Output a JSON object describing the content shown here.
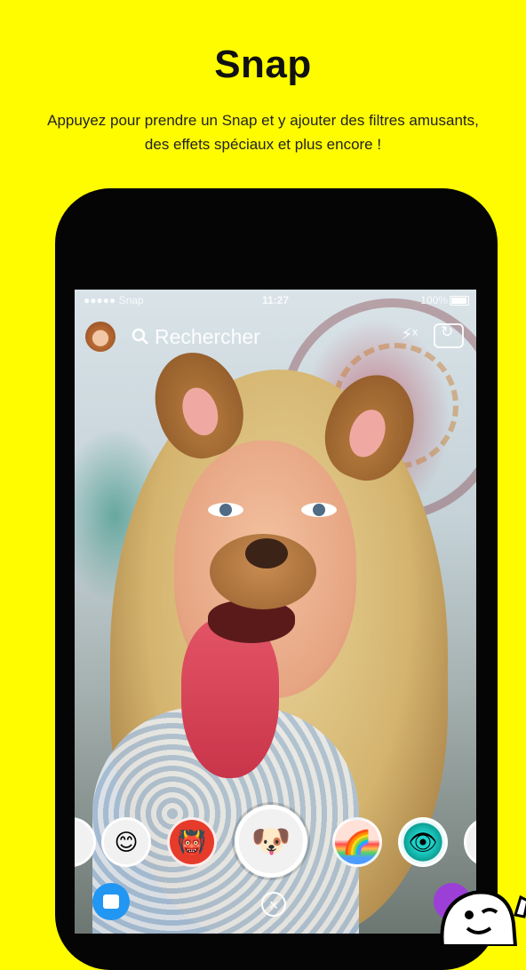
{
  "header": {
    "title": "Snap",
    "subtitle": "Appuyez pour prendre un Snap et y ajouter des filtres amusants, des effets spéciaux et plus encore !"
  },
  "status_bar": {
    "carrier": "●●●●● Snap",
    "time": "11:27",
    "battery": "100%"
  },
  "camera": {
    "search_label": "Rechercher",
    "flash_icon": "flash-off-icon",
    "flip_icon": "flip-camera-icon"
  },
  "lenses": [
    {
      "icon": "partial-lens-left",
      "glyph": ""
    },
    {
      "icon": "cute-face-lens",
      "glyph": "😊"
    },
    {
      "icon": "devil-lens",
      "glyph": "👹"
    },
    {
      "icon": "dog-lens-selected",
      "glyph": "🐶"
    },
    {
      "icon": "rainbow-lens",
      "glyph": "🌈"
    },
    {
      "icon": "teal-eye-lens",
      "glyph": "👁"
    }
  ],
  "bottom_bar": {
    "close_glyph": "×"
  },
  "colors": {
    "background": "#fffc00",
    "chat_button": "#2196f3",
    "stories_button": "#9b3fd6"
  }
}
